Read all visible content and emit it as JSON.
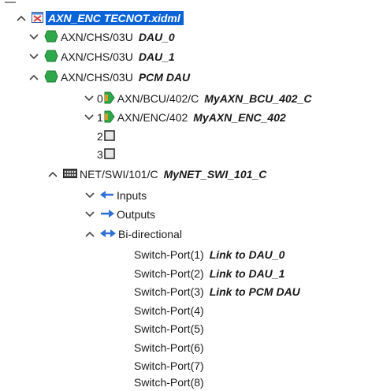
{
  "root": {
    "label": "AXN_ENC TECNOT.xidml"
  },
  "chassis": [
    {
      "type": "AXN/CHS/03U",
      "name": "DAU_0",
      "expanded": false
    },
    {
      "type": "AXN/CHS/03U",
      "name": "DAU_1",
      "expanded": false
    },
    {
      "type": "AXN/CHS/03U",
      "name": "PCM DAU",
      "expanded": true
    }
  ],
  "slots": [
    {
      "index": "0",
      "type": "AXN/BCU/402/C",
      "name": "MyAXN_BCU_402_C"
    },
    {
      "index": "1",
      "type": "AXN/ENC/402",
      "name": "MyAXN_ENC_402"
    },
    {
      "index": "2"
    },
    {
      "index": "3"
    }
  ],
  "switch": {
    "type": "NET/SWI/101/C",
    "name": "MyNET_SWI_101_C"
  },
  "groups": [
    "Inputs",
    "Outputs",
    "Bi-directional"
  ],
  "ports": [
    {
      "label": "Switch-Port(1)",
      "link": "Link to DAU_0"
    },
    {
      "label": "Switch-Port(2)",
      "link": "Link to DAU_1"
    },
    {
      "label": "Switch-Port(3)",
      "link": "Link to PCM DAU"
    },
    {
      "label": "Switch-Port(4)",
      "link": ""
    },
    {
      "label": "Switch-Port(5)",
      "link": ""
    },
    {
      "label": "Switch-Port(6)",
      "link": ""
    },
    {
      "label": "Switch-Port(7)",
      "link": ""
    },
    {
      "label": "Switch-Port(8)",
      "link": ""
    }
  ],
  "colors": {
    "selection": "#0a64d8",
    "module_green": "#2ea84a",
    "arrow_blue": "#2f6fd6"
  }
}
